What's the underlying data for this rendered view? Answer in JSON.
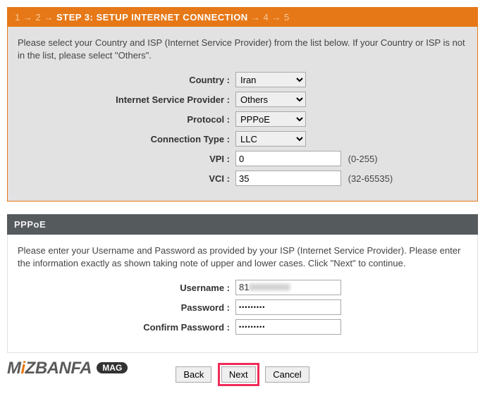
{
  "wizard": {
    "step1": "1",
    "step2": "2",
    "arrow": "→",
    "current": "STEP 3: SETUP INTERNET CONNECTION",
    "step4": "4",
    "step5": "5"
  },
  "intro": "Please select your Country and ISP (Internet Service Provider) from the list below. If your Country or ISP is not in the list, please select \"Others\".",
  "labels": {
    "country": "Country :",
    "isp": "Internet Service Provider :",
    "protocol": "Protocol :",
    "conn_type": "Connection Type :",
    "vpi": "VPI :",
    "vci": "VCI :",
    "username": "Username :",
    "password": "Password :",
    "confirm": "Confirm Password :"
  },
  "values": {
    "country": "Iran",
    "isp": "Others",
    "protocol": "PPPoE",
    "conn_type": "LLC",
    "vpi": "0",
    "vci": "35",
    "username_prefix": "81",
    "username_blur": "00000000",
    "password": "•••••••••",
    "confirm": "•••••••••"
  },
  "hints": {
    "vpi": "(0-255)",
    "vci": "(32-65535)"
  },
  "pppoe": {
    "title": "PPPoE",
    "instr": "Please enter your Username and Password as provided by your ISP (Internet Service Provider). Please enter the information exactly as shown taking note of upper and lower cases. Click \"Next\" to continue."
  },
  "buttons": {
    "back": "Back",
    "next": "Next",
    "cancel": "Cancel"
  },
  "brand": {
    "pre": "M",
    "accent": "i",
    "rest": "ZBANFA",
    "tag": "MAG"
  }
}
